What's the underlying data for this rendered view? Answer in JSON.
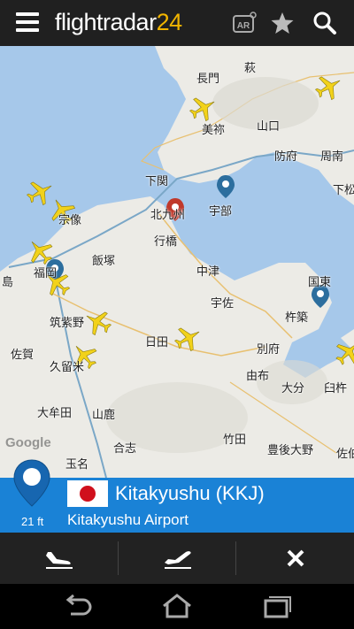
{
  "app": {
    "logo_main": "flightradar",
    "logo_num": "24"
  },
  "toolbar": {
    "menu_icon": "hamburger-menu-icon",
    "ar_label": "AR",
    "ar_icon": "augmented-reality-icon",
    "favorite_icon": "star-icon",
    "search_icon": "search-icon"
  },
  "map": {
    "places": [
      {
        "label": "長門"
      },
      {
        "label": "萩"
      },
      {
        "label": "美祢"
      },
      {
        "label": "山口"
      },
      {
        "label": "防府"
      },
      {
        "label": "周南"
      },
      {
        "label": "下関"
      },
      {
        "label": "宇部"
      },
      {
        "label": "下松"
      },
      {
        "label": "宗像"
      },
      {
        "label": "北九州"
      },
      {
        "label": "行橋"
      },
      {
        "label": "福岡"
      },
      {
        "label": "飯塚"
      },
      {
        "label": "中津"
      },
      {
        "label": "国東"
      },
      {
        "label": "宇佐"
      },
      {
        "label": "杵築"
      },
      {
        "label": "筑紫野"
      },
      {
        "label": "日田"
      },
      {
        "label": "別府"
      },
      {
        "label": "佐賀"
      },
      {
        "label": "久留米"
      },
      {
        "label": "由布"
      },
      {
        "label": "大分"
      },
      {
        "label": "臼杵"
      },
      {
        "label": "大牟田"
      },
      {
        "label": "山鹿"
      },
      {
        "label": "竹田"
      },
      {
        "label": "豊後大野"
      },
      {
        "label": "合志"
      },
      {
        "label": "玉名"
      },
      {
        "label": "佐伯"
      },
      {
        "label": "島"
      }
    ],
    "attribution": "Google"
  },
  "selection": {
    "altitude": "21 ft",
    "country_flag": "japan-flag",
    "airport_code_title": "Kitakyushu (KKJ)",
    "airport_name": "Kitakyushu Airport"
  },
  "actions": [
    {
      "icon": "arrivals-plane-icon"
    },
    {
      "icon": "departures-plane-icon"
    },
    {
      "icon": "close-icon"
    }
  ],
  "system_nav": [
    {
      "icon": "back-icon"
    },
    {
      "icon": "home-icon"
    },
    {
      "icon": "recent-apps-icon"
    }
  ],
  "colors": {
    "toolbar_bg": "#202020",
    "accent": "#1a82d6",
    "logo_accent": "#f0b400",
    "water": "#a6c8ea",
    "land": "#ecebe6",
    "plane": "#f2d21a"
  }
}
